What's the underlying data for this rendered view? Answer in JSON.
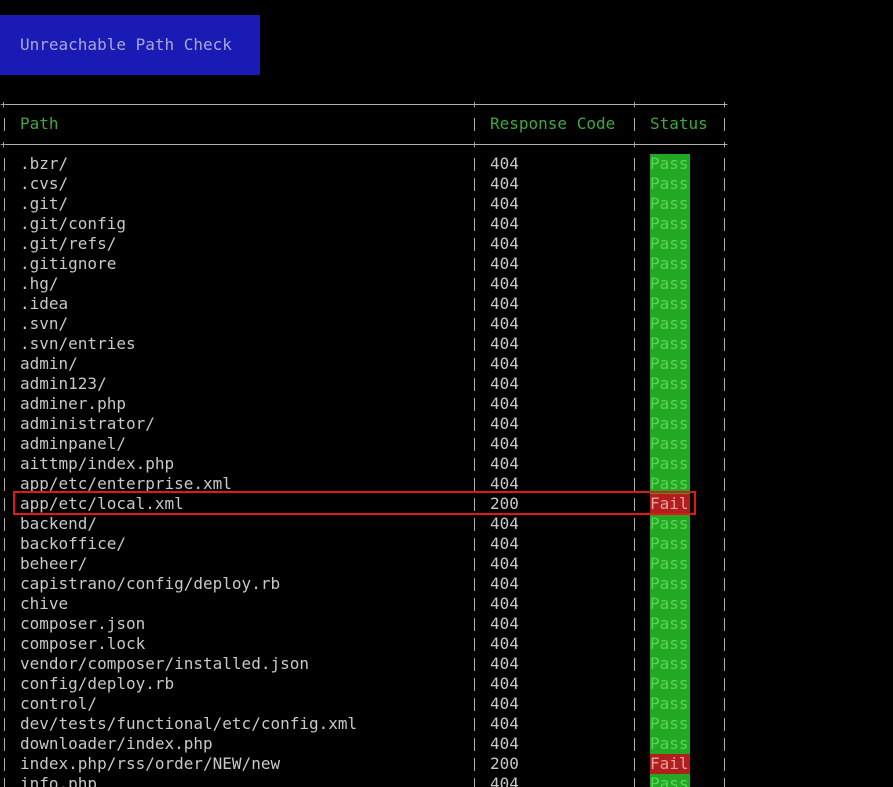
{
  "title_button": "Unreachable Path Check",
  "columns": {
    "path": "Path",
    "code": "Response Code",
    "status": "Status"
  },
  "rows": [
    {
      "path": ".bzr/",
      "code": "404",
      "status": "Pass"
    },
    {
      "path": ".cvs/",
      "code": "404",
      "status": "Pass"
    },
    {
      "path": ".git/",
      "code": "404",
      "status": "Pass"
    },
    {
      "path": ".git/config",
      "code": "404",
      "status": "Pass"
    },
    {
      "path": ".git/refs/",
      "code": "404",
      "status": "Pass"
    },
    {
      "path": ".gitignore",
      "code": "404",
      "status": "Pass"
    },
    {
      "path": ".hg/",
      "code": "404",
      "status": "Pass"
    },
    {
      "path": ".idea",
      "code": "404",
      "status": "Pass"
    },
    {
      "path": ".svn/",
      "code": "404",
      "status": "Pass"
    },
    {
      "path": ".svn/entries",
      "code": "404",
      "status": "Pass"
    },
    {
      "path": "admin/",
      "code": "404",
      "status": "Pass"
    },
    {
      "path": "admin123/",
      "code": "404",
      "status": "Pass"
    },
    {
      "path": "adminer.php",
      "code": "404",
      "status": "Pass"
    },
    {
      "path": "administrator/",
      "code": "404",
      "status": "Pass"
    },
    {
      "path": "adminpanel/",
      "code": "404",
      "status": "Pass"
    },
    {
      "path": "aittmp/index.php",
      "code": "404",
      "status": "Pass"
    },
    {
      "path": "app/etc/enterprise.xml",
      "code": "404",
      "status": "Pass"
    },
    {
      "path": "app/etc/local.xml",
      "code": "200",
      "status": "Fail"
    },
    {
      "path": "backend/",
      "code": "404",
      "status": "Pass"
    },
    {
      "path": "backoffice/",
      "code": "404",
      "status": "Pass"
    },
    {
      "path": "beheer/",
      "code": "404",
      "status": "Pass"
    },
    {
      "path": "capistrano/config/deploy.rb",
      "code": "404",
      "status": "Pass"
    },
    {
      "path": "chive",
      "code": "404",
      "status": "Pass"
    },
    {
      "path": "composer.json",
      "code": "404",
      "status": "Pass"
    },
    {
      "path": "composer.lock",
      "code": "404",
      "status": "Pass"
    },
    {
      "path": "vendor/composer/installed.json",
      "code": "404",
      "status": "Pass"
    },
    {
      "path": "config/deploy.rb",
      "code": "404",
      "status": "Pass"
    },
    {
      "path": "control/",
      "code": "404",
      "status": "Pass"
    },
    {
      "path": "dev/tests/functional/etc/config.xml",
      "code": "404",
      "status": "Pass"
    },
    {
      "path": "downloader/index.php",
      "code": "404",
      "status": "Pass"
    },
    {
      "path": "index.php/rss/order/NEW/new",
      "code": "200",
      "status": "Fail"
    },
    {
      "path": "info.php",
      "code": "404",
      "status": "Pass"
    }
  ],
  "colors": {
    "title_bg": "#1a1ab4",
    "header_text": "#3ea83e",
    "pass_bg": "#22a822",
    "fail_bg": "#b01e1e",
    "highlight": "#e01818"
  }
}
